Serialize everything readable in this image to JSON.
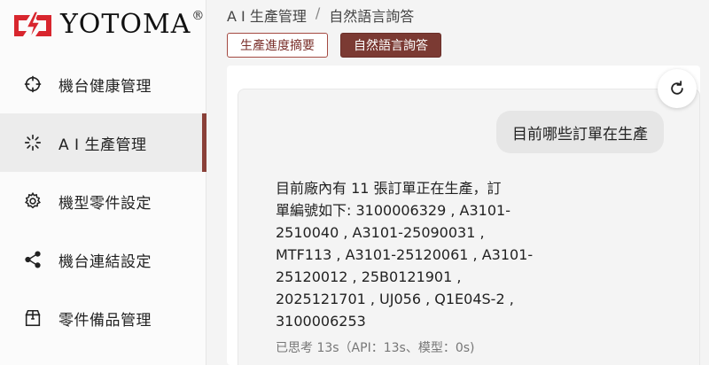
{
  "brand": {
    "name": "YOTOMA",
    "reg": "®"
  },
  "sidebar": {
    "items": [
      {
        "label": "機台健康管理",
        "icon": "crosshair-icon"
      },
      {
        "label": "A I 生產管理",
        "icon": "loading-spinner-icon",
        "active": true
      },
      {
        "label": "機型零件設定",
        "icon": "gear-icon"
      },
      {
        "label": "機台連結設定",
        "icon": "share-icon"
      },
      {
        "label": "零件備品管理",
        "icon": "package-icon"
      }
    ]
  },
  "breadcrumb": {
    "parent": "A I 生產管理",
    "separator": "/",
    "current": "自然語言詢答"
  },
  "tabs": [
    {
      "label": "生產進度摘要",
      "selected": false
    },
    {
      "label": "自然語言詢答",
      "selected": true
    }
  ],
  "chat": {
    "user_message": "目前哪些訂單在生產",
    "answer_lines": [
      "目前廠內有 11 張訂單正在生產，訂",
      "單編號如下: 3100006329 , A3101-",
      "2510040 , A3101-25090031 ,",
      "MTF113 , A3101-25120061 , A3101-",
      "25120012 , 25B0121901 ,",
      "2025121701 , UJ056 , Q1E04S-2 ,",
      "3100006253"
    ],
    "meta": "已思考 13s（API：13s、模型：0s)"
  },
  "colors": {
    "accent": "#7b3a33",
    "logo_red": "#d8262e"
  }
}
